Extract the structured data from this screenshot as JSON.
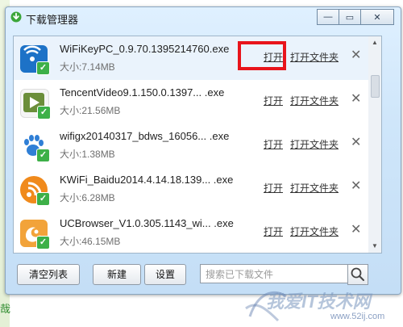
{
  "window": {
    "title": "下载管理器",
    "controls": {
      "restore": "▭",
      "minimize": "—",
      "close": "✕"
    }
  },
  "background": {
    "bottom_text": "哉"
  },
  "rows": [
    {
      "name": "WiFiKeyPC_0.9.70.1395214760.exe",
      "size": "大小:7.14MB",
      "open": "打开",
      "folder": "打开文件夹",
      "remove": "✕",
      "icon": "wifi-key-icon",
      "icon_color": "#1d72c7"
    },
    {
      "name": "TencentVideo9.1.150.0.1397... .exe",
      "size": "大小:21.56MB",
      "open": "打开",
      "folder": "打开文件夹",
      "remove": "✕",
      "icon": "tencent-video-icon",
      "icon_color": "#2f9e44"
    },
    {
      "name": "wifigx20140317_bdws_16056... .exe",
      "size": "大小:1.38MB",
      "open": "打开",
      "folder": "打开文件夹",
      "remove": "✕",
      "icon": "baidu-paw-icon",
      "icon_color": "#2f7fd6"
    },
    {
      "name": "KWiFi_Baidu2014.4.14.18.139... .exe",
      "size": "大小:6.28MB",
      "open": "打开",
      "folder": "打开文件夹",
      "remove": "✕",
      "icon": "kwifi-icon",
      "icon_color": "#f08a1c"
    },
    {
      "name": "UCBrowser_V1.0.305.1143_wi... .exe",
      "size": "大小:46.15MB",
      "open": "打开",
      "folder": "打开文件夹",
      "remove": "✕",
      "icon": "uc-browser-icon",
      "icon_color": "#f2a33a"
    }
  ],
  "toolbar": {
    "clear_list": "清空列表",
    "new": "新建",
    "settings": "设置",
    "search_placeholder": "搜索已下载文件"
  },
  "watermark": {
    "text": "我爱IT技术网",
    "url": "www.52ij.com"
  }
}
